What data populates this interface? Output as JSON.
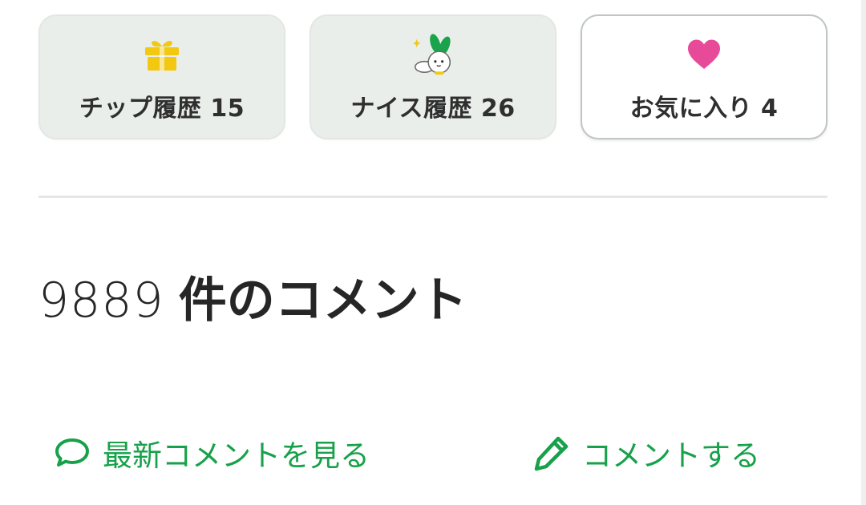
{
  "history_cards": [
    {
      "label": "チップ履歴 15",
      "icon": "gift-icon",
      "icon_color": "#f2c811"
    },
    {
      "label": "ナイス履歴 26",
      "icon": "rabbit-mascot-icon",
      "icon_color": "#1aa34a"
    },
    {
      "label": "お気に入り 4",
      "icon": "heart-icon",
      "icon_color": "#e84a9a"
    }
  ],
  "comments": {
    "count": "9889",
    "count_suffix": "件のコメント"
  },
  "actions": {
    "latest_label": "最新コメントを見る",
    "latest_icon": "speech-bubble-icon",
    "post_label": "コメントする",
    "post_icon": "pencil-icon",
    "accent_color": "#17a14a"
  }
}
